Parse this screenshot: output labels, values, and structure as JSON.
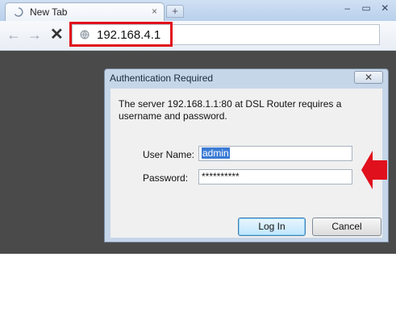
{
  "browser": {
    "tab": {
      "title": "New Tab",
      "close_glyph": "×"
    },
    "new_tab_glyph": "+",
    "window_controls": [
      "–",
      "▭",
      "✕"
    ],
    "nav": {
      "back_glyph": "←",
      "forward_glyph": "→",
      "stop_glyph": "✕"
    },
    "address": {
      "url": "192.168.4.1",
      "highlight_color": "#e0101c"
    }
  },
  "dialog": {
    "title": "Authentication Required",
    "close_glyph": "✕",
    "message": "The server 192.168.1.1:80 at DSL Router requires a username and password.",
    "username_label": "User Name:",
    "username_value": "admin",
    "password_label": "Password:",
    "password_value": "**********",
    "login_label": "Log In",
    "cancel_label": "Cancel"
  },
  "annotations": {
    "arrow_color": "#e0101c"
  },
  "colors": {
    "page_background": "#4a4a4a",
    "dialog_frame": "#c6d6e9"
  }
}
